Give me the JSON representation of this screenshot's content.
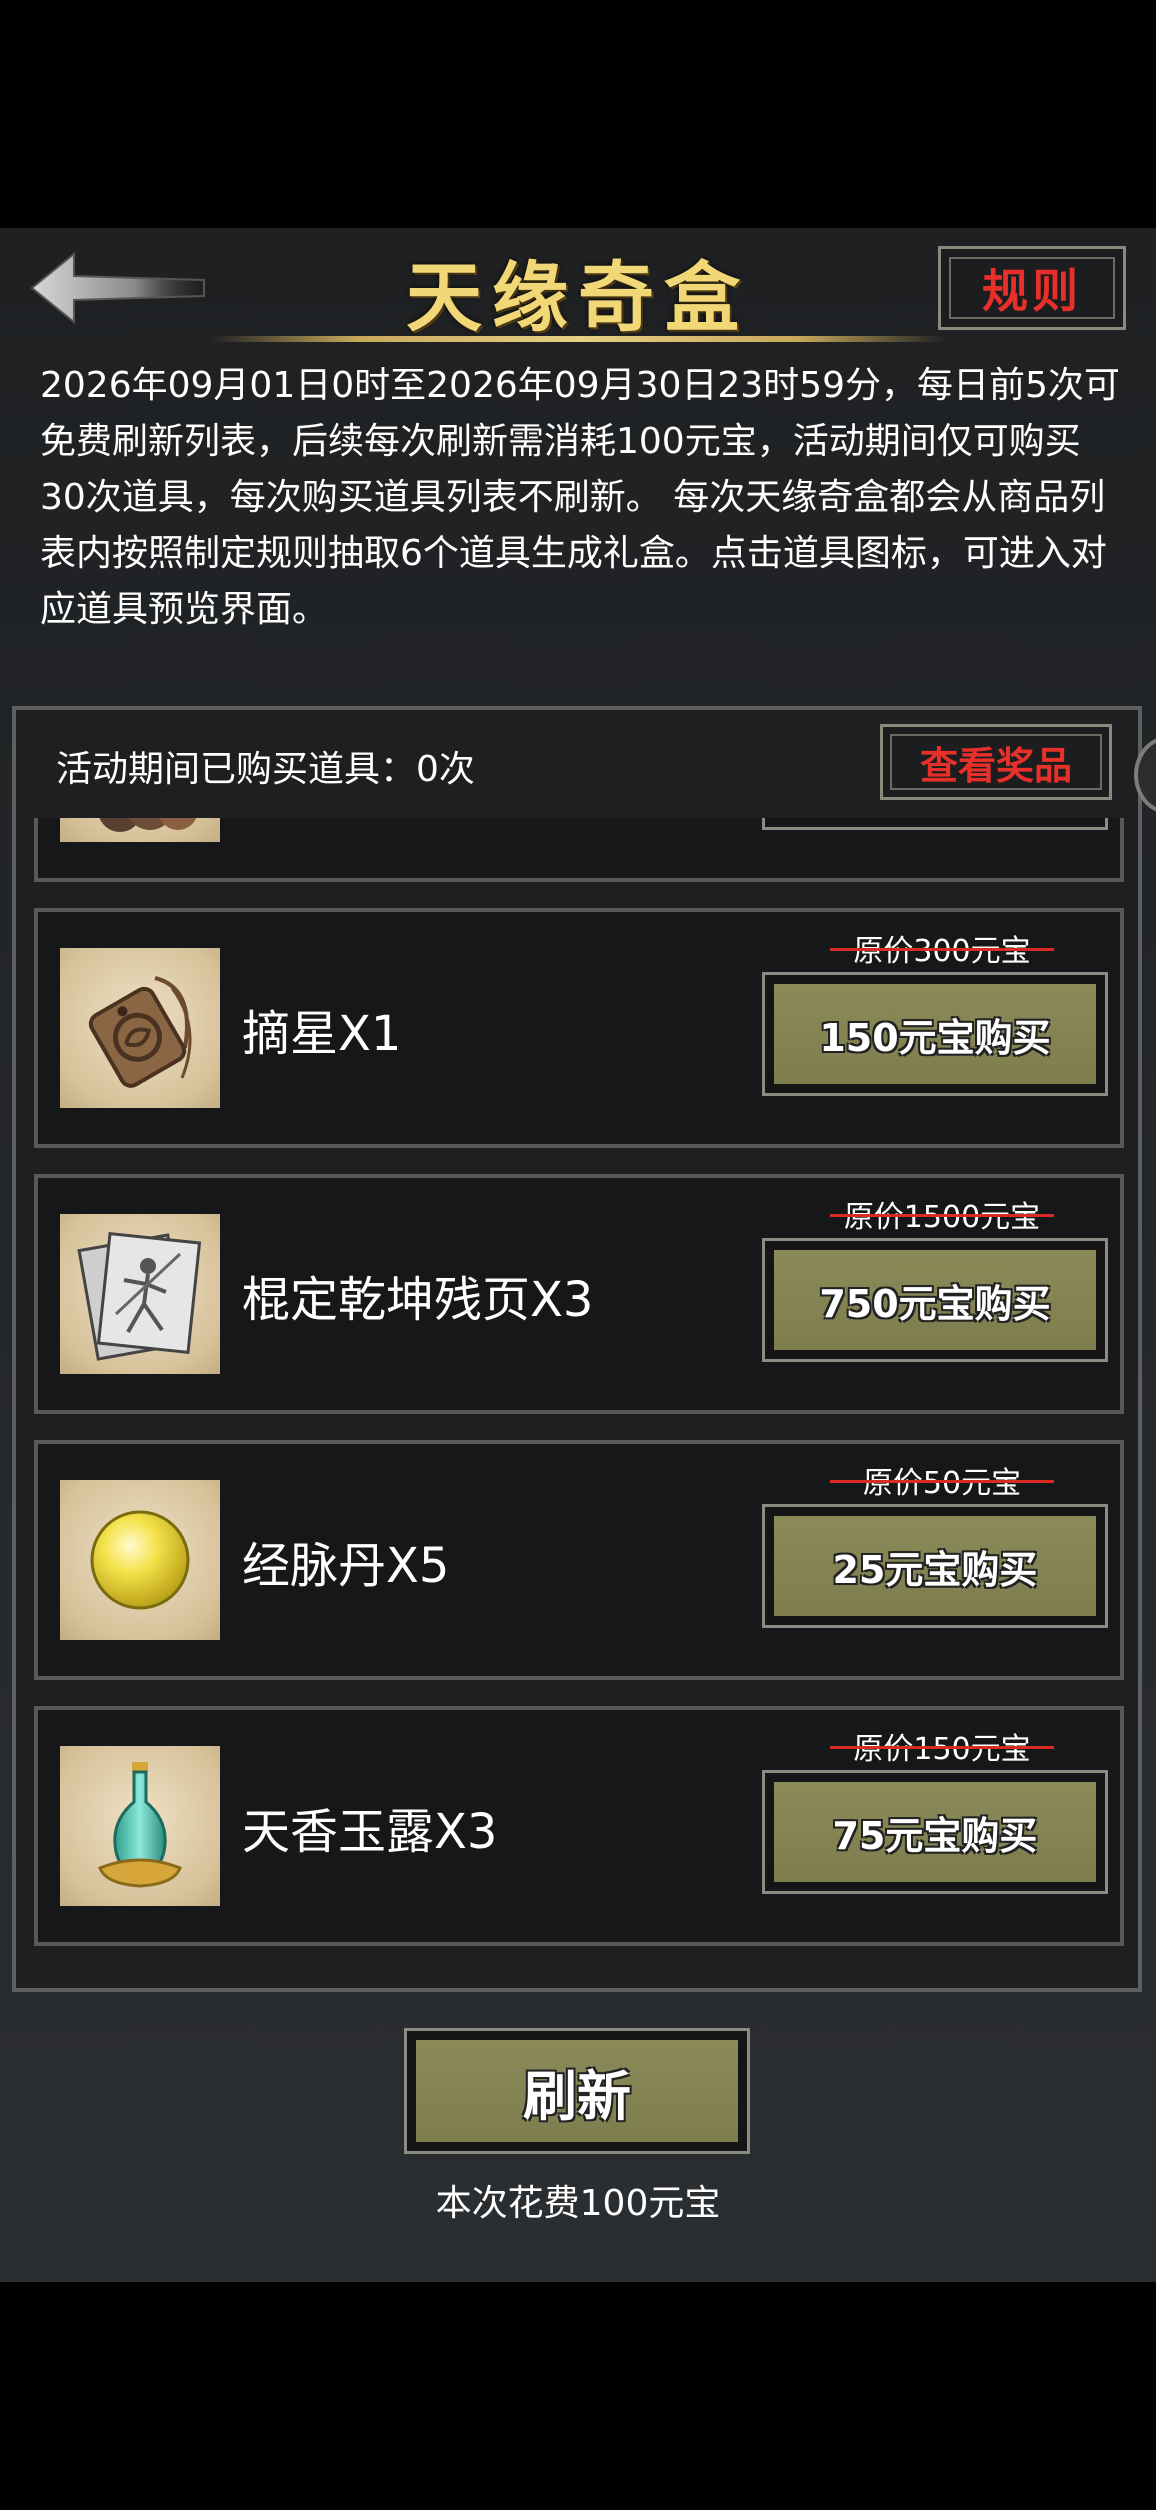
{
  "header": {
    "title": "天缘奇盒",
    "rules_label": "规则"
  },
  "description": "2026年09月01日0时至2026年09月30日23时59分，每日前5次可免费刷新列表，后续每次刷新需消耗100元宝，活动期间仅可购买30次道具，每次购买道具列表不刷新。 每次天缘奇盒都会从商品列表内按照制定规则抽取6个道具生成礼盒。点击道具图标，可进入对应道具预览界面。",
  "panel": {
    "purchase_count_text": "活动期间已购买道具：0次",
    "view_prizes_label": "查看奖品",
    "items": [
      {
        "name": "",
        "original_price": "",
        "buy_label": "",
        "icon": "cloud-ornament-icon"
      },
      {
        "name": "摘星X1",
        "original_price": "原价300元宝",
        "buy_label": "150元宝购买",
        "icon": "token-pendant-icon"
      },
      {
        "name": "棍定乾坤残页X3",
        "original_price": "原价1500元宝",
        "buy_label": "750元宝购买",
        "icon": "scroll-pages-icon"
      },
      {
        "name": "经脉丹X5",
        "original_price": "原价50元宝",
        "buy_label": "25元宝购买",
        "icon": "yellow-pill-icon"
      },
      {
        "name": "天香玉露X3",
        "original_price": "原价150元宝",
        "buy_label": "75元宝购买",
        "icon": "jade-vase-icon"
      }
    ]
  },
  "footer": {
    "refresh_label": "刷新",
    "cost_text": "本次花费100元宝"
  }
}
